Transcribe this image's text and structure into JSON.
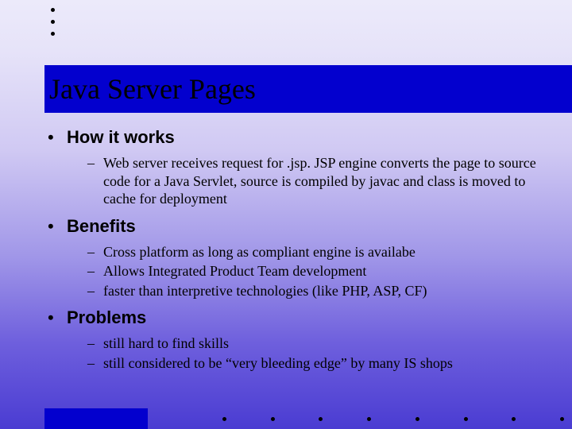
{
  "title": "Java Server Pages",
  "sections": [
    {
      "heading": "How it works",
      "items": [
        "Web server receives request for .jsp. JSP engine converts the page to source code for a Java Servlet, source is compiled by javac and class is moved  to cache for deployment"
      ]
    },
    {
      "heading": "Benefits",
      "items": [
        "Cross platform as long as compliant engine is availabe",
        "Allows Integrated Product Team development",
        "faster than interpretive technologies (like PHP, ASP, CF)"
      ]
    },
    {
      "heading": "Problems",
      "items": [
        "still hard to find skills",
        "still considered to be “very bleeding edge” by many IS shops"
      ]
    }
  ]
}
